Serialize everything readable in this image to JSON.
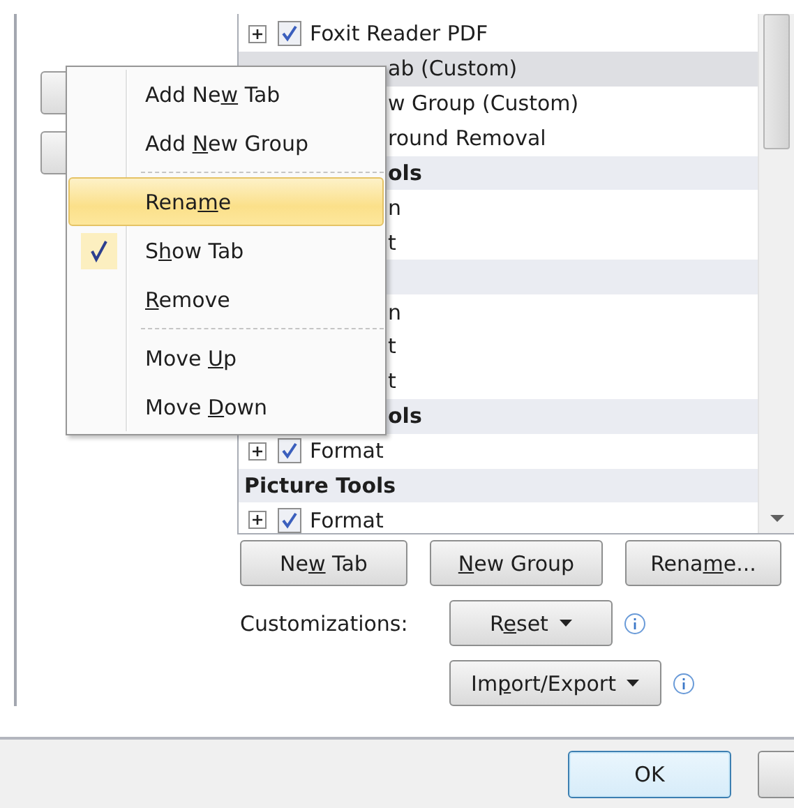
{
  "ribbon_tree": {
    "rows": [
      {
        "kind": "item",
        "text": "Foxit Reader PDF",
        "covered": false,
        "checked": true,
        "selected": false
      },
      {
        "kind": "item",
        "text": "ab (Custom)",
        "covered": true,
        "selected": true
      },
      {
        "kind": "item",
        "text": "w Group (Custom)",
        "covered": true,
        "selected": false
      },
      {
        "kind": "item",
        "text": "round Removal",
        "covered": true,
        "selected": false
      },
      {
        "kind": "header",
        "text": "ols",
        "covered": true,
        "selected": false
      },
      {
        "kind": "item",
        "text": "n",
        "covered": true,
        "selected": false
      },
      {
        "kind": "item",
        "text": "t",
        "covered": true,
        "selected": false
      },
      {
        "kind": "header",
        "selected": false
      },
      {
        "kind": "item",
        "text": "n",
        "covered": true,
        "selected": false
      },
      {
        "kind": "item",
        "text": "t",
        "covered": true,
        "selected": false
      },
      {
        "kind": "item",
        "text": "t",
        "covered": true,
        "selected": false
      },
      {
        "kind": "header",
        "text": "ols",
        "covered": true,
        "selected": false
      },
      {
        "kind": "item",
        "text": "Format",
        "covered": false,
        "checked": true,
        "selected": false
      },
      {
        "kind": "header",
        "text": "Picture Tools",
        "covered": false,
        "selected": false
      },
      {
        "kind": "item",
        "text": "Format",
        "covered": false,
        "checked": true,
        "selected": false
      }
    ]
  },
  "tree_buttons": [
    {
      "label_parts": {
        "before": "Ne",
        "key": "w",
        "after": " Tab"
      }
    },
    {
      "label_parts": {
        "key": "N",
        "after": "ew Group"
      }
    },
    {
      "label_parts": {
        "before": "Rena",
        "key": "m",
        "after": "e..."
      }
    }
  ],
  "customizations": {
    "label": "Customizations:",
    "buttons": [
      {
        "label_parts": {
          "before": "R",
          "key": "e",
          "after": "set"
        }
      },
      {
        "label_parts": {
          "before": "Im",
          "key": "p",
          "after": "ort/Export"
        }
      }
    ]
  },
  "context_menu": [
    {
      "kind": "item",
      "label_parts": {
        "before": "Add Ne",
        "key": "w",
        "after": " Tab"
      },
      "selected": false,
      "checked": false
    },
    {
      "kind": "item",
      "label_parts": {
        "before": "Add ",
        "key": "N",
        "after": "ew Group"
      },
      "selected": false,
      "checked": false
    },
    {
      "kind": "separator"
    },
    {
      "kind": "item",
      "label_parts": {
        "before": "Rena",
        "key": "m",
        "after": "e"
      },
      "selected": true,
      "checked": false
    },
    {
      "kind": "item",
      "label_parts": {
        "before": "S",
        "key": "h",
        "after": "ow Tab"
      },
      "selected": false,
      "checked": true
    },
    {
      "kind": "item",
      "label_parts": {
        "key": "R",
        "after": "emove"
      },
      "selected": false,
      "checked": false
    },
    {
      "kind": "separator"
    },
    {
      "kind": "item",
      "label_parts": {
        "before": "Move ",
        "key": "U",
        "after": "p"
      },
      "selected": false,
      "checked": false
    },
    {
      "kind": "item",
      "label_parts": {
        "before": "Move ",
        "key": "D",
        "after": "own"
      },
      "selected": false,
      "checked": false
    }
  ],
  "footer": {
    "ok_button": "OK"
  }
}
